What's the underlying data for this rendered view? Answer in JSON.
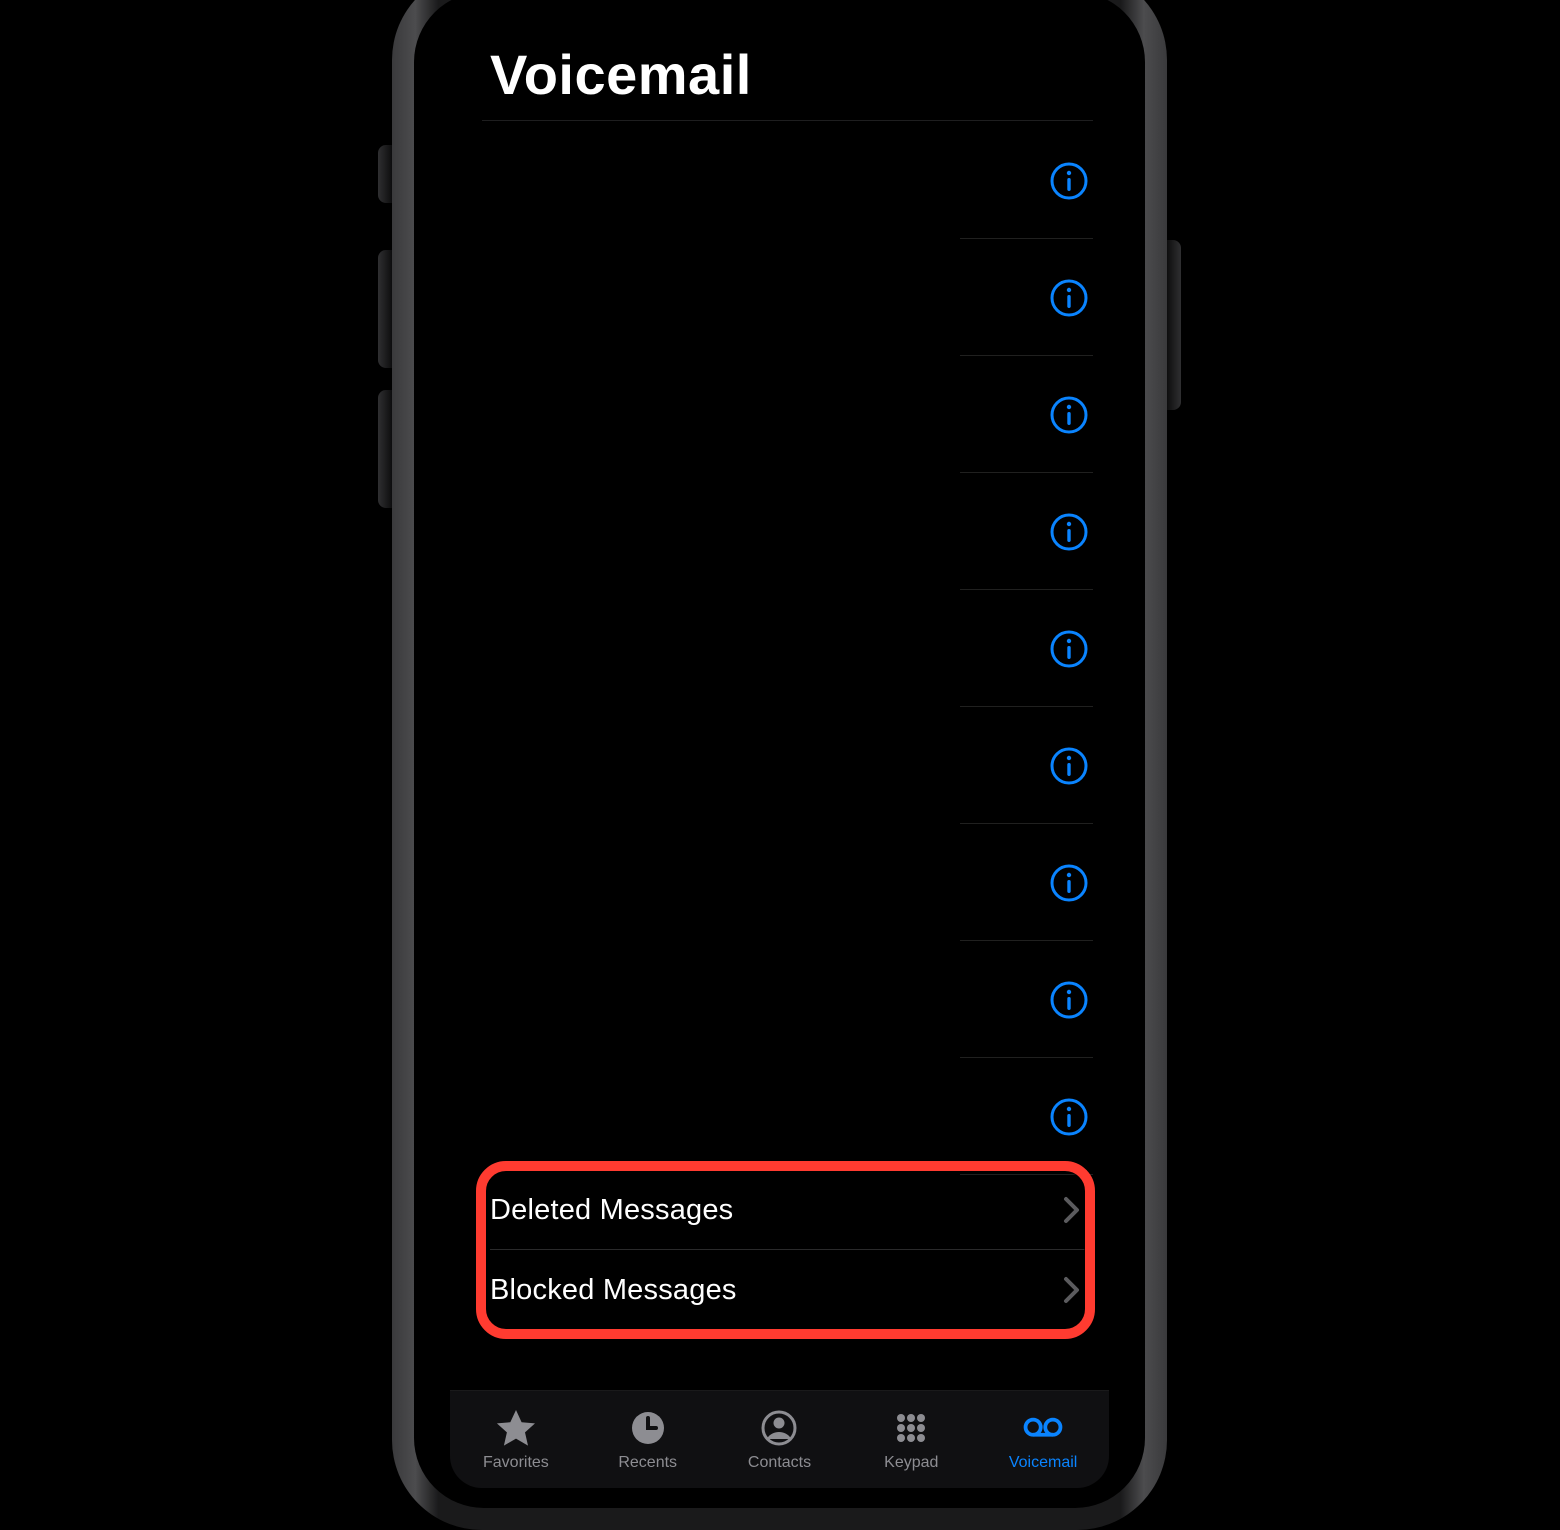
{
  "header": {
    "title": "Voicemail"
  },
  "voicemail": {
    "rows": [
      {},
      {},
      {},
      {},
      {},
      {},
      {},
      {},
      {}
    ]
  },
  "links": {
    "deleted": {
      "label": "Deleted Messages"
    },
    "blocked": {
      "label": "Blocked Messages"
    }
  },
  "tabs": {
    "favorites": {
      "label": "Favorites"
    },
    "recents": {
      "label": "Recents"
    },
    "contacts": {
      "label": "Contacts"
    },
    "keypad": {
      "label": "Keypad"
    },
    "voicemail": {
      "label": "Voicemail",
      "active": true
    }
  },
  "colors": {
    "accent": "#0a84ff",
    "inactive": "#8d8d92",
    "highlight": "#ff3b30"
  }
}
